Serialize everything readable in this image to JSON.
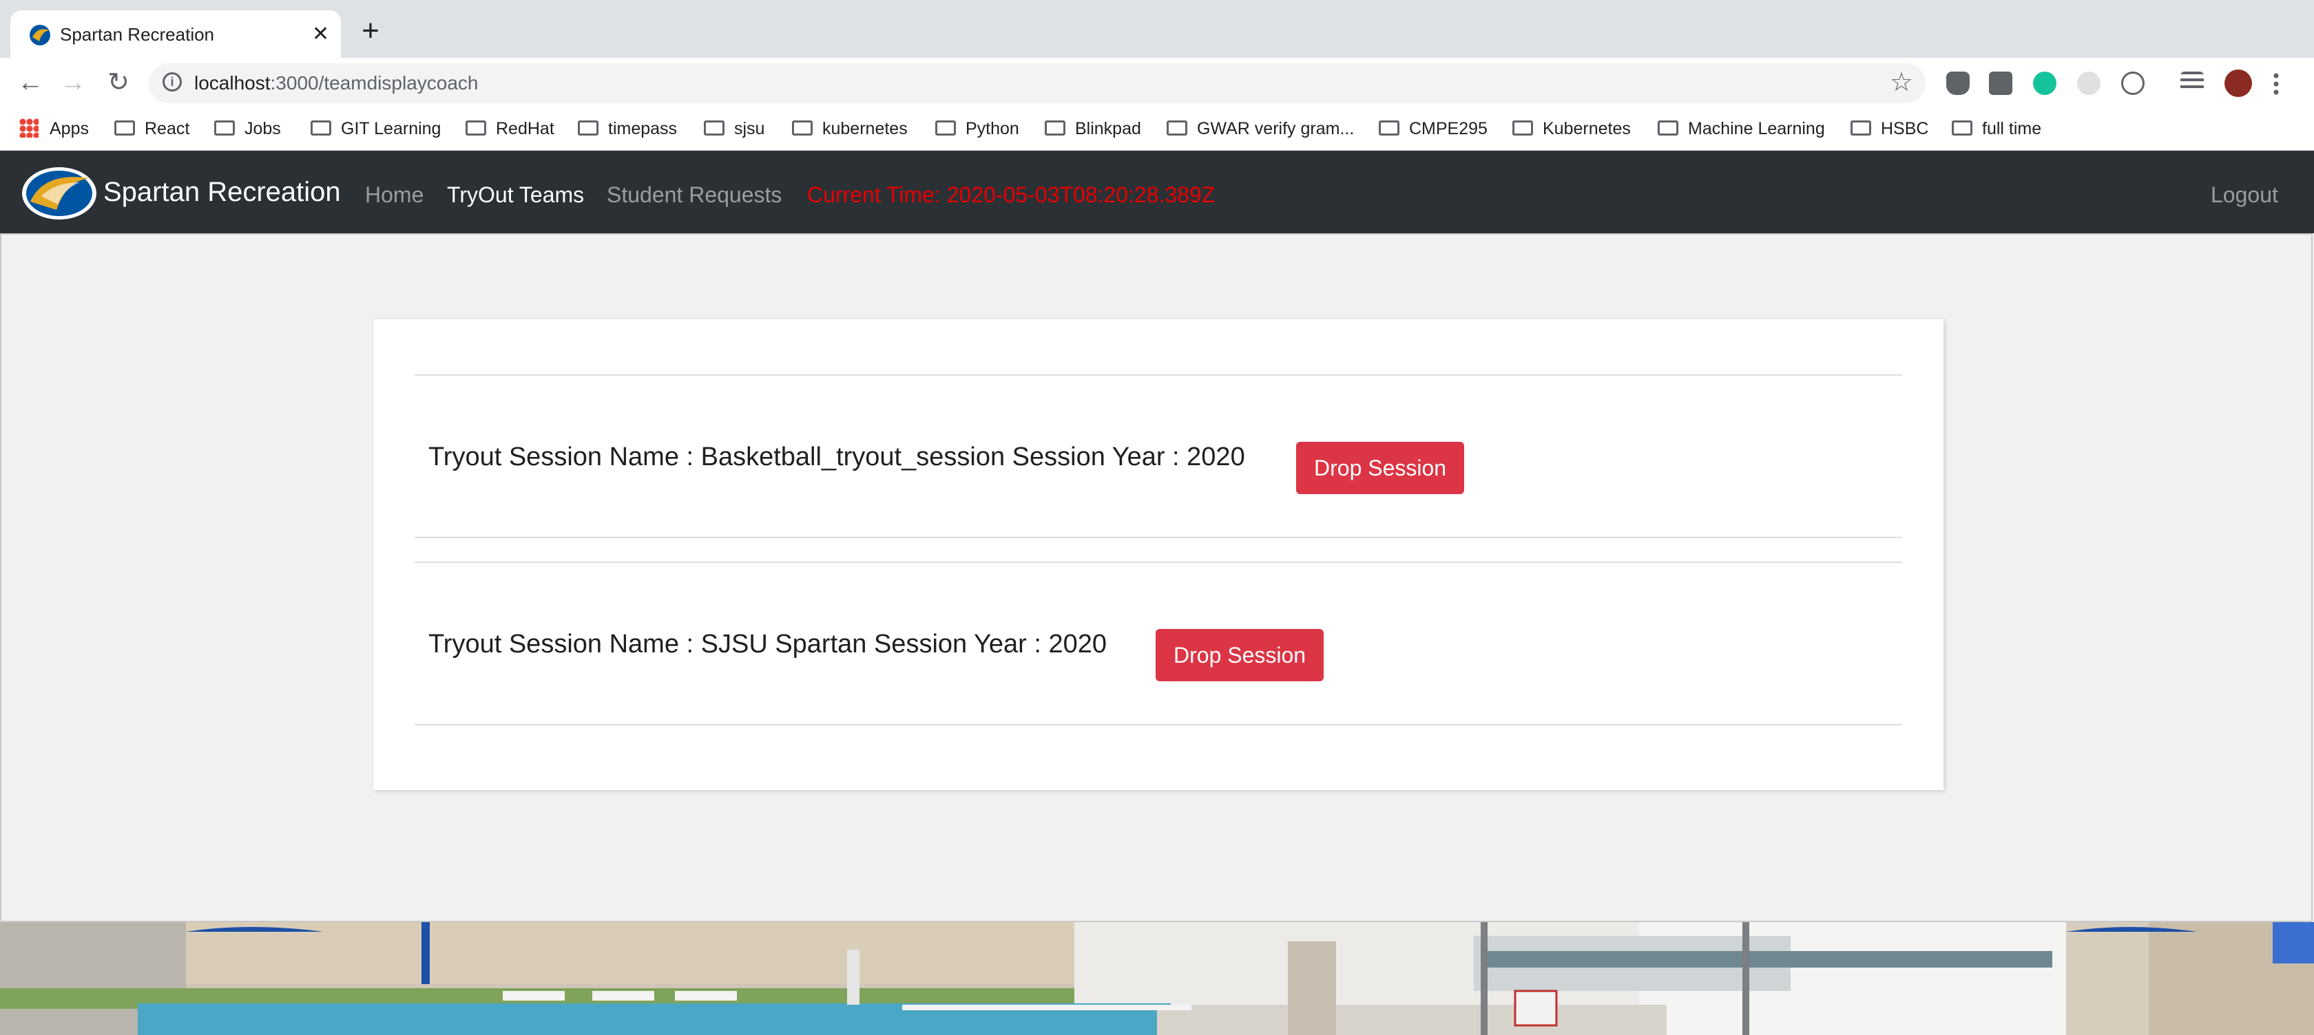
{
  "browser": {
    "tab_title": "Spartan Recreation",
    "tab_close": "✕",
    "new_tab": "+",
    "back": "←",
    "forward": "→",
    "reload": "↻",
    "url_host": "localhost",
    "url_path": ":3000/teamdisplaycoach",
    "star": "☆"
  },
  "bookmarks": [
    {
      "label": "Apps",
      "icon": "apps-grid-icon"
    },
    {
      "label": "React",
      "icon": "folder-icon"
    },
    {
      "label": "Jobs",
      "icon": "folder-icon"
    },
    {
      "label": "GIT Learning",
      "icon": "folder-icon"
    },
    {
      "label": "RedHat",
      "icon": "folder-icon"
    },
    {
      "label": "timepass",
      "icon": "folder-icon"
    },
    {
      "label": "sjsu",
      "icon": "folder-icon"
    },
    {
      "label": "kubernetes",
      "icon": "folder-icon"
    },
    {
      "label": "Python",
      "icon": "folder-icon"
    },
    {
      "label": "Blinkpad",
      "icon": "folder-icon"
    },
    {
      "label": "GWAR verify gram...",
      "icon": "folder-icon"
    },
    {
      "label": "CMPE295",
      "icon": "folder-icon"
    },
    {
      "label": "Kubernetes",
      "icon": "folder-icon"
    },
    {
      "label": "Machine Learning",
      "icon": "folder-icon"
    },
    {
      "label": "HSBC",
      "icon": "folder-icon"
    },
    {
      "label": "full time",
      "icon": "folder-icon"
    }
  ],
  "navbar": {
    "brand": "Spartan Recreation",
    "links": {
      "home": "Home",
      "tryout_teams": "TryOut Teams",
      "student_requests": "Student Requests"
    },
    "current_time": "Current Time: 2020-05-03T08:20:28.389Z",
    "logout": "Logout"
  },
  "sessions": [
    {
      "label": "Tryout Session Name : Basketball_tryout_session Session Year : 2020",
      "button": "Drop Session"
    },
    {
      "label": "Tryout Session Name : SJSU Spartan Session Year : 2020",
      "button": "Drop Session"
    }
  ],
  "colors": {
    "navbar_bg": "#2b3035",
    "danger": "#dc3545",
    "clock": "#e60000"
  }
}
